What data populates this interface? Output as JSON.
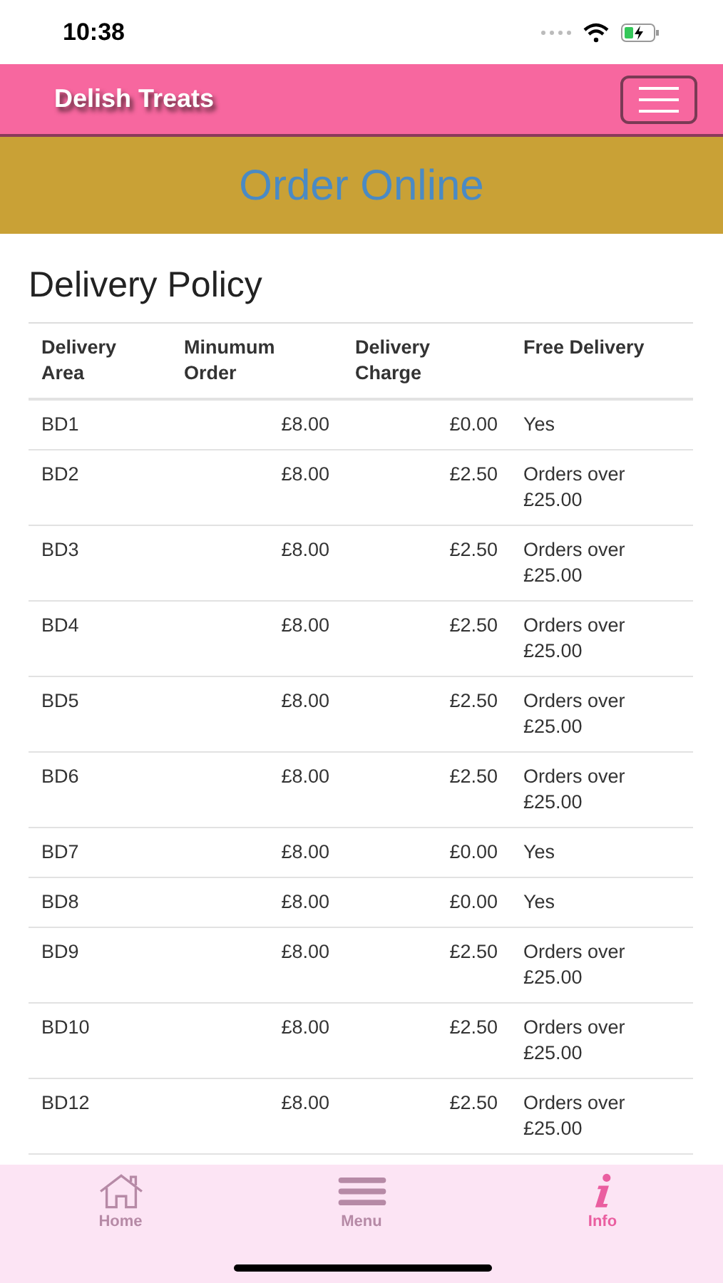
{
  "status_bar": {
    "time": "10:38"
  },
  "header": {
    "brand": "Delish Treats"
  },
  "banner": {
    "title": "Order Online"
  },
  "section": {
    "title": "Delivery Policy"
  },
  "table": {
    "columns": [
      "Delivery Area",
      "Minumum Order",
      "Delivery Charge",
      "Free Delivery"
    ],
    "rows": [
      [
        "BD1",
        "£8.00",
        "£0.00",
        "Yes"
      ],
      [
        "BD2",
        "£8.00",
        "£2.50",
        "Orders over £25.00"
      ],
      [
        "BD3",
        "£8.00",
        "£2.50",
        "Orders over £25.00"
      ],
      [
        "BD4",
        "£8.00",
        "£2.50",
        "Orders over £25.00"
      ],
      [
        "BD5",
        "£8.00",
        "£2.50",
        "Orders over £25.00"
      ],
      [
        "BD6",
        "£8.00",
        "£2.50",
        "Orders over £25.00"
      ],
      [
        "BD7",
        "£8.00",
        "£0.00",
        "Yes"
      ],
      [
        "BD8",
        "£8.00",
        "£0.00",
        "Yes"
      ],
      [
        "BD9",
        "£8.00",
        "£2.50",
        "Orders over £25.00"
      ],
      [
        "BD10",
        "£8.00",
        "£2.50",
        "Orders over £25.00"
      ],
      [
        "BD12",
        "£8.00",
        "£2.50",
        "Orders over £25.00"
      ]
    ]
  },
  "tab_bar": [
    {
      "kind": "home",
      "label": "Home",
      "selected": false
    },
    {
      "kind": "menu",
      "label": "Menu",
      "selected": false
    },
    {
      "kind": "info",
      "label": "Info",
      "selected": true
    }
  ]
}
